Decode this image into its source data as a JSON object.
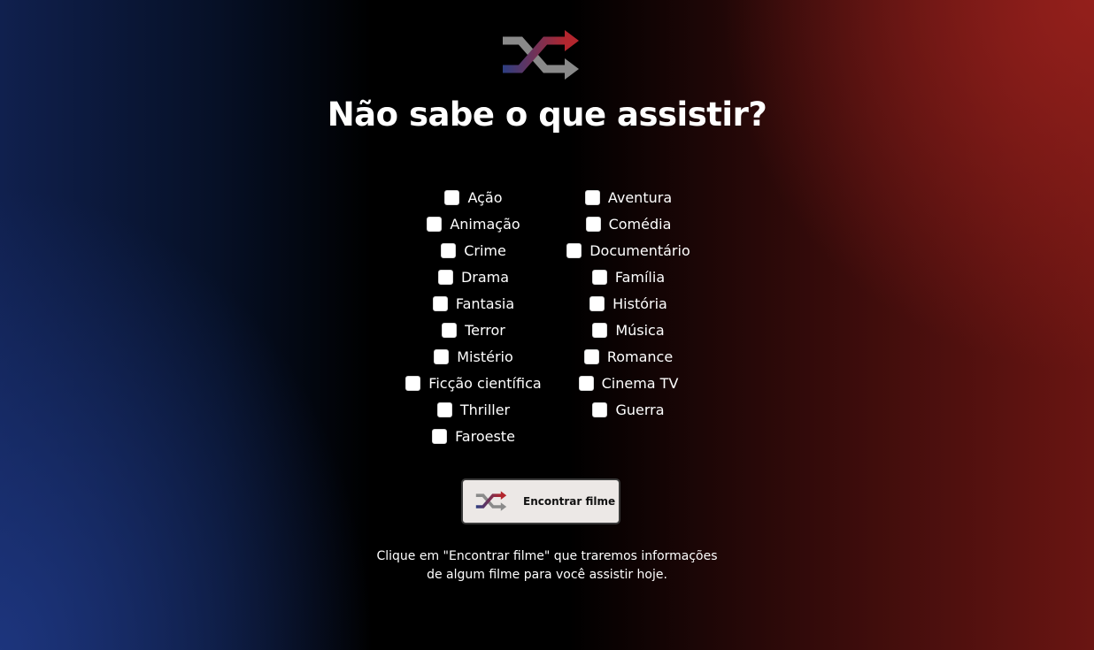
{
  "logo": {
    "icon": "shuffle-icon",
    "colors": [
      "#2d3e82",
      "#b3262e",
      "#8a8a8a"
    ]
  },
  "page": {
    "title": "Não sabe o que assistir?"
  },
  "genres": {
    "left": [
      "Ação",
      "Animação",
      "Crime",
      "Drama",
      "Fantasia",
      "Terror",
      "Mistério",
      "Ficção científica",
      "Thriller",
      "Faroeste"
    ],
    "right": [
      "Aventura",
      "Comédia",
      "Documentário",
      "Família",
      "História",
      "Música",
      "Romance",
      "Cinema TV",
      "Guerra"
    ]
  },
  "button": {
    "label": "Encontrar filme",
    "icon": "shuffle-icon"
  },
  "hint": {
    "line1": "Clique em \"Encontrar filme\" que traremos informações",
    "line2": "de algum filme para você assistir hoje."
  }
}
